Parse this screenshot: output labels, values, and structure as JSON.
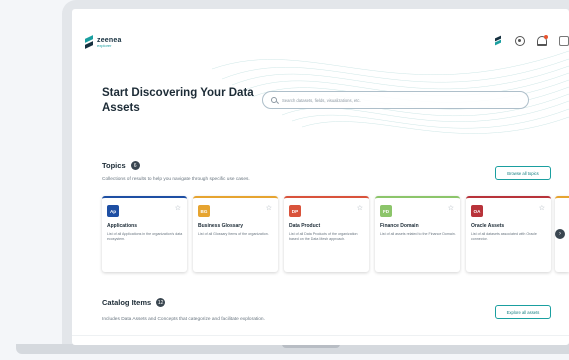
{
  "app": {
    "logo_name": "zeenea",
    "logo_sub": "explorer"
  },
  "hero": {
    "title": "Start Discovering Your Data Assets",
    "search_placeholder": "Search datasets, fields, visualizations, etc."
  },
  "topics": {
    "title": "Topics",
    "count": "6",
    "description": "Collections of results to help you navigate through specific use cases.",
    "browse_label": "Browse all topics",
    "cards": [
      {
        "badge": "Ap",
        "badge_color": "#1e4fa3",
        "accent": "#1e4fa3",
        "title": "Applications",
        "description": "List of all Applications in the organization's data ecosystem."
      },
      {
        "badge": "BG",
        "badge_color": "#e6a430",
        "accent": "#e6a430",
        "title": "Business Glossary",
        "description": "List of all Glossary Items of the organization."
      },
      {
        "badge": "DP",
        "badge_color": "#d9533b",
        "accent": "#d9533b",
        "title": "Data Product",
        "description": "List of all Data Products of the organization based on the Data Mesh approach."
      },
      {
        "badge": "FD",
        "badge_color": "#8cc56a",
        "accent": "#8cc56a",
        "title": "Finance Domain",
        "description": "List of all assets related to the Finance Domain."
      },
      {
        "badge": "OA",
        "badge_color": "#b8333a",
        "accent": "#b8333a",
        "title": "Oracle Assets",
        "description": "List of all datasets associated with Oracle connector."
      }
    ]
  },
  "catalog": {
    "title": "Catalog Items",
    "count": "12",
    "description": "Includes Data Assets and Concepts that categorize and facilitate exploration.",
    "explore_label": "Explore all assets"
  },
  "icons": {
    "search": "search-icon",
    "star": "star-icon",
    "next": "chevron-right-icon"
  }
}
